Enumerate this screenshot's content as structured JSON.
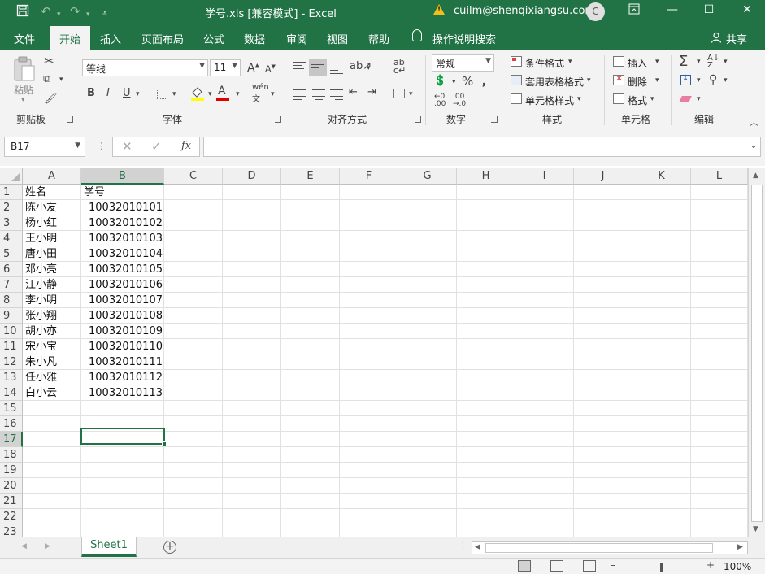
{
  "window": {
    "title": "学号.xls  [兼容模式]  -  Excel",
    "user": "cuilm@shenqixiangsu.com",
    "avatar_initial": "C"
  },
  "tabs": [
    "文件",
    "开始",
    "插入",
    "页面布局",
    "公式",
    "数据",
    "审阅",
    "视图",
    "帮助"
  ],
  "active_tab": "开始",
  "tell_me": "操作说明搜索",
  "share": "共享",
  "ribbon": {
    "clipboard": {
      "paste": "粘贴",
      "label": "剪贴板"
    },
    "font": {
      "name": "等线",
      "size": "11",
      "label": "字体",
      "bold": "B",
      "italic": "I",
      "underline": "U",
      "grow": "A",
      "shrink": "A",
      "color_a": "A"
    },
    "alignment": {
      "label": "对齐方式"
    },
    "number": {
      "format": "常规",
      "percent": "%",
      "comma": "，",
      "label": "数字"
    },
    "styles": {
      "conditional": "条件格式",
      "table": "套用表格格式",
      "cell": "单元格样式",
      "label": "样式"
    },
    "cells": {
      "insert": "插入",
      "delete": "删除",
      "format": "格式",
      "label": "单元格"
    },
    "editing": {
      "label": "编辑",
      "sum": "Σ"
    }
  },
  "formula_bar": {
    "name_box": "B17",
    "fx": "fx",
    "value": ""
  },
  "columns": [
    "A",
    "B",
    "C",
    "D",
    "E",
    "F",
    "G",
    "H",
    "I",
    "J",
    "K",
    "L"
  ],
  "row_numbers": [
    "1",
    "2",
    "3",
    "4",
    "5",
    "6",
    "7",
    "8",
    "9",
    "10",
    "11",
    "12",
    "13",
    "14",
    "15",
    "16",
    "17",
    "18",
    "19",
    "20",
    "21",
    "22",
    "23"
  ],
  "selected_cell": "B17",
  "rows": [
    [
      "姓名",
      "学号"
    ],
    [
      "陈小友",
      "10032010101"
    ],
    [
      "杨小红",
      "10032010102"
    ],
    [
      "王小明",
      "10032010103"
    ],
    [
      "唐小田",
      "10032010104"
    ],
    [
      "邓小亮",
      "10032010105"
    ],
    [
      "江小静",
      "10032010106"
    ],
    [
      "李小明",
      "10032010107"
    ],
    [
      "张小翔",
      "10032010108"
    ],
    [
      "胡小亦",
      "10032010109"
    ],
    [
      "宋小宝",
      "10032010110"
    ],
    [
      "朱小凡",
      "10032010111"
    ],
    [
      "任小雅",
      "10032010112"
    ],
    [
      "白小云",
      "10032010113"
    ]
  ],
  "sheets": [
    "Sheet1"
  ],
  "status": {
    "zoom": "100%",
    "zoom_level": 1.0
  }
}
